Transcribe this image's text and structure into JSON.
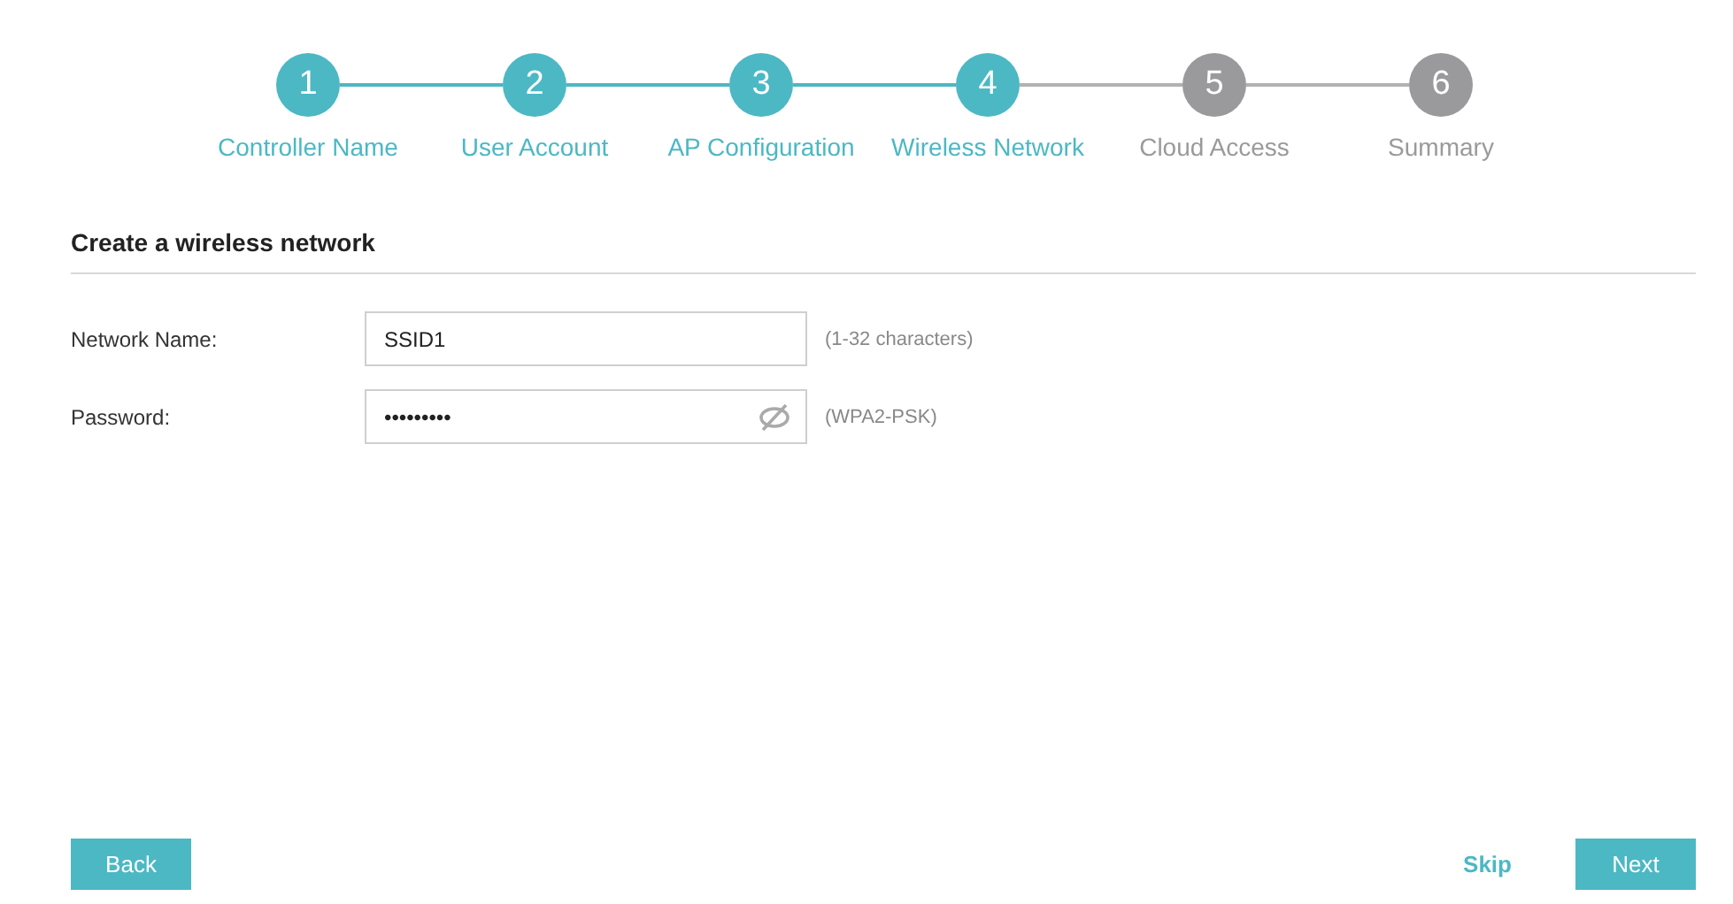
{
  "steps": [
    {
      "number": "1",
      "label": "Controller Name",
      "completed": true
    },
    {
      "number": "2",
      "label": "User Account",
      "completed": true
    },
    {
      "number": "3",
      "label": "AP Configuration",
      "completed": true
    },
    {
      "number": "4",
      "label": "Wireless Network",
      "completed": true
    },
    {
      "number": "5",
      "label": "Cloud Access",
      "completed": false
    },
    {
      "number": "6",
      "label": "Summary",
      "completed": false
    }
  ],
  "section_title": "Create a wireless network",
  "fields": [
    {
      "label": "Network Name:",
      "value": "SSID1",
      "hint": "(1-32 characters)",
      "kind": "text"
    },
    {
      "label": "Password:",
      "value": "•••••••••",
      "hint": "(WPA2-PSK)",
      "kind": "password"
    }
  ],
  "buttons": {
    "back": "Back",
    "skip": "Skip",
    "next": "Next"
  }
}
